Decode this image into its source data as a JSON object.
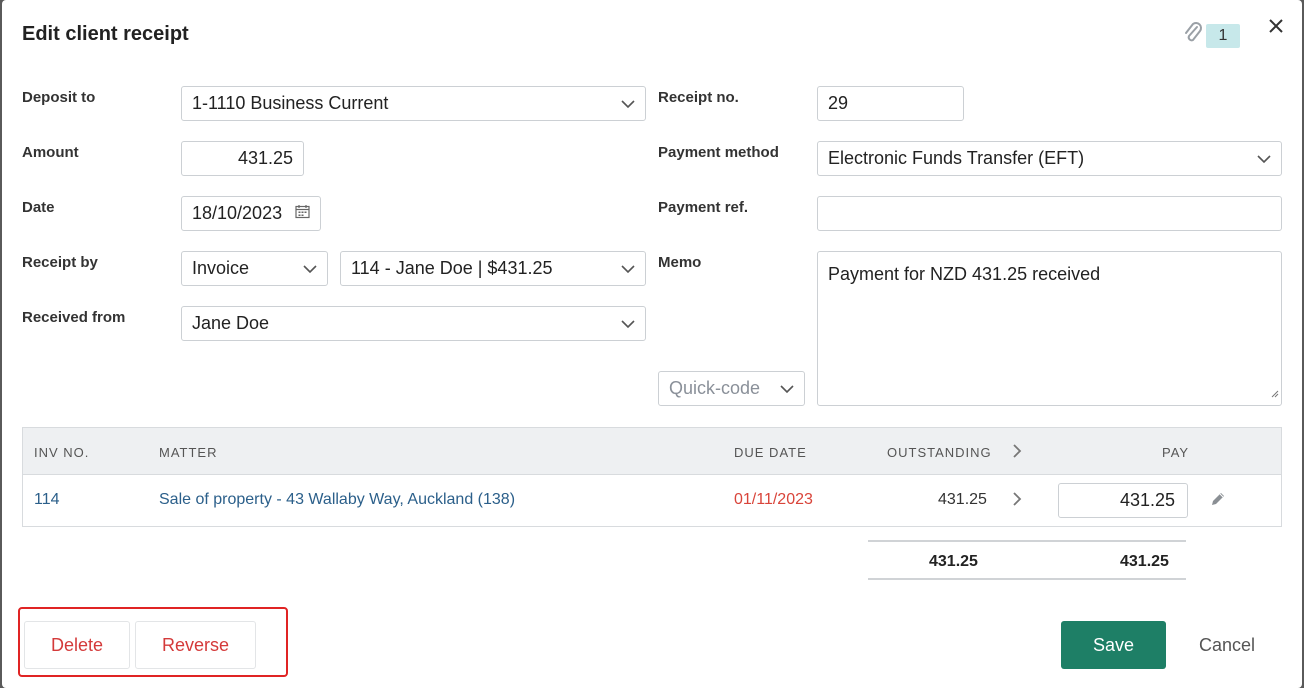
{
  "dialog": {
    "title": "Edit client receipt",
    "attachment_count": "1"
  },
  "form": {
    "deposit_to": {
      "label": "Deposit to",
      "value": "1-1110 Business Current"
    },
    "amount": {
      "label": "Amount",
      "value": "431.25"
    },
    "date": {
      "label": "Date",
      "value": "18/10/2023"
    },
    "receipt_by": {
      "label": "Receipt by",
      "type_value": "Invoice",
      "invoice_value": "114 - Jane Doe | $431.25"
    },
    "received_from": {
      "label": "Received from",
      "value": "Jane Doe"
    },
    "receipt_no": {
      "label": "Receipt no.",
      "value": "29"
    },
    "payment_method": {
      "label": "Payment method",
      "value": "Electronic Funds Transfer (EFT)"
    },
    "payment_ref": {
      "label": "Payment ref.",
      "value": ""
    },
    "memo": {
      "label": "Memo",
      "value": "Payment for NZD 431.25 received"
    },
    "quick_code": {
      "placeholder": "Quick-code"
    }
  },
  "table": {
    "headers": {
      "inv_no": "INV NO.",
      "matter": "MATTER",
      "due_date": "DUE DATE",
      "outstanding": "OUTSTANDING",
      "pay": "PAY"
    },
    "rows": [
      {
        "inv_no": "114",
        "matter": "Sale of property - 43 Wallaby Way, Auckland (138)",
        "due_date": "01/11/2023",
        "outstanding": "431.25",
        "pay": "431.25"
      }
    ],
    "totals": {
      "outstanding": "431.25",
      "pay": "431.25"
    }
  },
  "footer": {
    "delete_label": "Delete",
    "reverse_label": "Reverse",
    "save_label": "Save",
    "cancel_label": "Cancel"
  },
  "colors": {
    "save_button": "#1e7f66",
    "danger_text": "#d43a3a",
    "highlight_border": "#e02424",
    "link": "#2b5f8a",
    "badge_bg": "#c7e8ea"
  }
}
